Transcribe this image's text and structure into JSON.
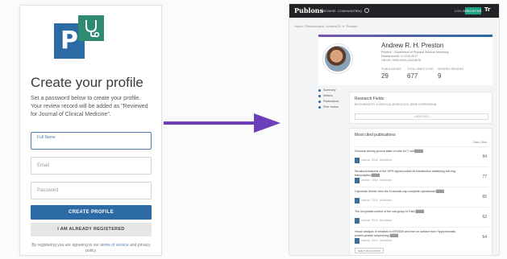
{
  "left": {
    "title": "Create your profile",
    "description": "Set a password below to create your profile. Your review record will be added as \"Reviewed for Journal of Clinical Medicine\".",
    "full_name_placeholder": "Full Name",
    "email_placeholder": "Email",
    "password_placeholder": "Password",
    "create_button": "CREATE PROFILE",
    "registered_button": "I AM ALREADY REGISTERED",
    "terms_prefix": "By registering you are agreeing to our ",
    "terms_link": "terms of service",
    "terms_mid": " and privacy policy.",
    "colors": {
      "primary": "#2c6aa5",
      "logo_p": "#2a6ba6",
      "logo_steth": "#2f8a72"
    },
    "logo_letter": "P"
  },
  "arrow_color": "#6a3fb8",
  "right": {
    "topbar": {
      "brand": "Publons",
      "nav": [
        "BROWSE",
        "COMMUNITY",
        "FAQ"
      ],
      "login": "LOG IN",
      "join": "REGISTER",
      "tr_logo": "Tr"
    },
    "breadcrumb": "Home  /  Researchers  /  Andrew R. H. Preston",
    "profile": {
      "name": "Andrew R. H. Preston",
      "info1": "Position · Department of Physical Science University",
      "info2": "ResearcherID: D-1234-2017",
      "info3": "ORCID: 0000-0002-1234-5678",
      "stats": [
        {
          "label": "PUBLICATIONS",
          "value": "29"
        },
        {
          "label": "TOTAL TIMES CITED",
          "value": "677"
        },
        {
          "label": "VERIFIED REVIEWS",
          "value": "9"
        }
      ]
    },
    "sidenav": [
      "Summary",
      "Metrics",
      "Publications",
      "Peer review"
    ],
    "research_fields": {
      "title": "Research Fields",
      "subtitle": "BIOCHEMISTRY & MOLECULAR BIOLOGY, GENE EXPRESSION",
      "button": "+ ADD FIELD"
    },
    "publications": {
      "title": "Most cited publications",
      "col_header": "Times Cited",
      "items": [
        {
          "title": "Genome-driving ground state of cells for T-cell ",
          "meta": "Journal · 2016 · All authors",
          "count": "94"
        },
        {
          "title": "Structural features of the GPR signal protein hit transfection stabilizing cell ring transcription ",
          "meta": "Journal · 2015 · All authors",
          "count": "77"
        },
        {
          "title": "Glycoside thinner from the N-domain cap complete operational ",
          "meta": "Journal · 2014 · All authors",
          "count": "65"
        },
        {
          "title": "The enzymatic control of the sub-group in DNA ",
          "meta": "Journal · 2013 · All authors",
          "count": "62"
        },
        {
          "title": "Visual analysis of residues in ERS3D0 and Iron on surface from Hygrostomatic protein-protein sequencing ",
          "meta": "Journal · 2012 · All authors",
          "count": "54"
        }
      ],
      "more_button": "SEE PUBLICATIONS"
    }
  }
}
